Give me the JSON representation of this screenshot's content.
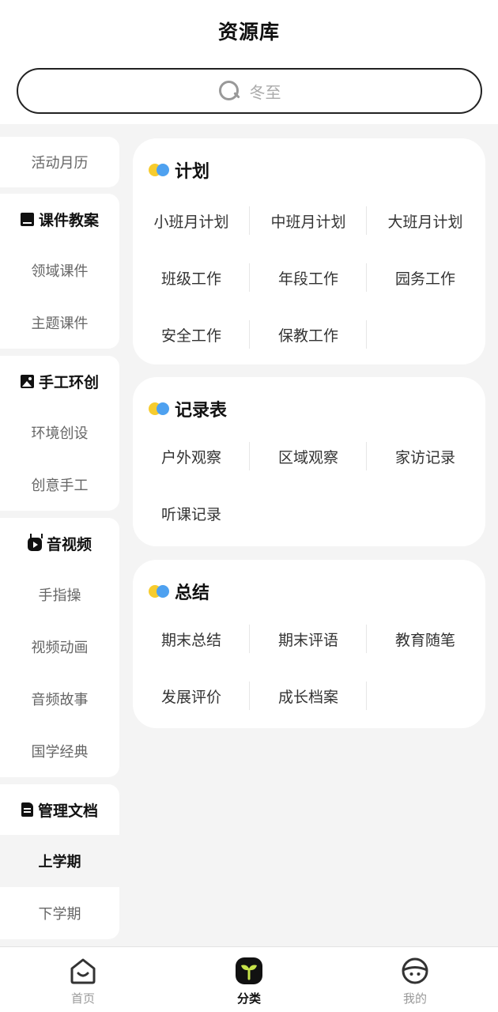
{
  "header": {
    "title": "资源库"
  },
  "search": {
    "placeholder": "冬至"
  },
  "sidebar": {
    "top_item": "活动月历",
    "groups": [
      {
        "title": "课件教案",
        "icon": "book-icon",
        "items": [
          "领域课件",
          "主题课件"
        ]
      },
      {
        "title": "手工环创",
        "icon": "image-icon",
        "items": [
          "环境创设",
          "创意手工"
        ]
      },
      {
        "title": "音视频",
        "icon": "tv-icon",
        "items": [
          "手指操",
          "视频动画",
          "音频故事",
          "国学经典"
        ]
      },
      {
        "title": "管理文档",
        "icon": "document-icon",
        "items": [
          "上学期",
          "下学期"
        ],
        "active_item": "上学期"
      }
    ]
  },
  "cards": [
    {
      "title": "计划",
      "rows": [
        [
          "小班月计划",
          "中班月计划",
          "大班月计划"
        ],
        [
          "班级工作",
          "年段工作",
          "园务工作"
        ],
        [
          "安全工作",
          "保教工作"
        ]
      ]
    },
    {
      "title": "记录表",
      "rows": [
        [
          "户外观察",
          "区域观察",
          "家访记录"
        ],
        [
          "听课记录"
        ]
      ]
    },
    {
      "title": "总结",
      "rows": [
        [
          "期末总结",
          "期末评语",
          "教育随笔"
        ],
        [
          "发展评价",
          "成长档案"
        ]
      ]
    }
  ],
  "tabbar": {
    "items": [
      {
        "label": "首页",
        "icon": "home-icon"
      },
      {
        "label": "分类",
        "icon": "category-icon",
        "active": true
      },
      {
        "label": "我的",
        "icon": "profile-icon"
      }
    ]
  },
  "colors": {
    "accent_yellow": "#f7cc2e",
    "accent_blue": "#4ea1f0",
    "highlight_green": "#c7e34a",
    "background": "#f4f4f4"
  }
}
